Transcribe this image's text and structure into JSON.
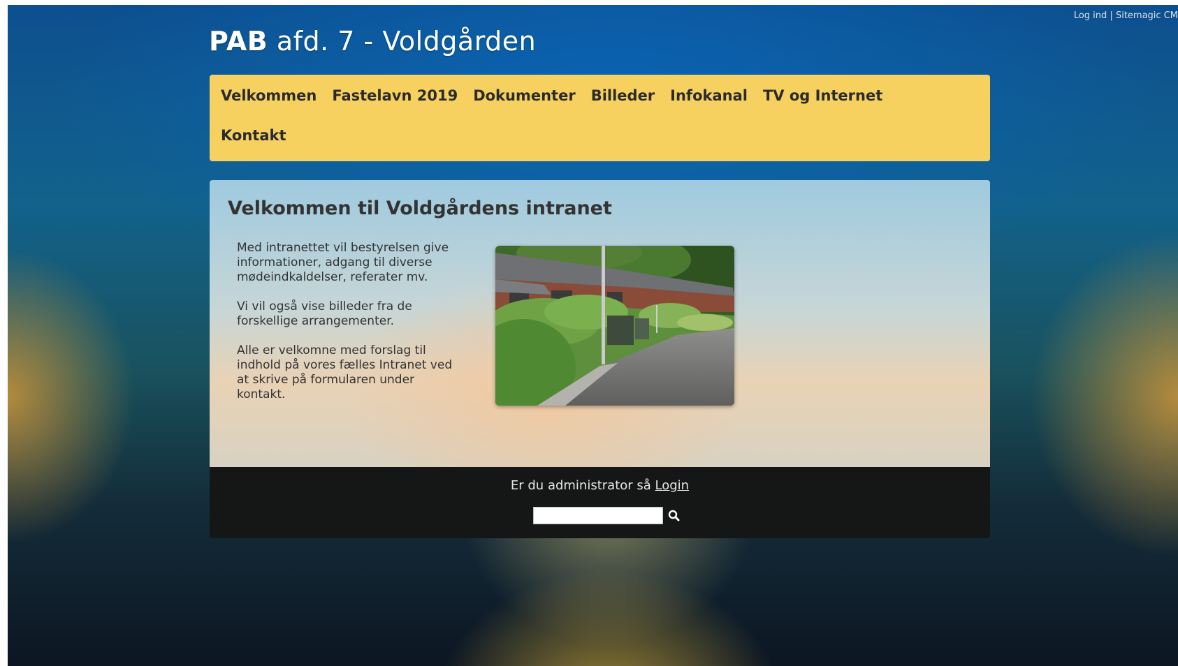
{
  "toplinks": {
    "login": "Log ind",
    "separator": "|",
    "sitemagic": "Sitemagic CM"
  },
  "site": {
    "title_bold": "PAB",
    "title_rest": " afd. 7 - Voldgården"
  },
  "nav": {
    "items": [
      {
        "label": "Velkommen"
      },
      {
        "label": "Fastelavn 2019"
      },
      {
        "label": "Dokumenter"
      },
      {
        "label": "Billeder"
      },
      {
        "label": "Infokanal"
      },
      {
        "label": "TV og Internet"
      },
      {
        "label": "Kontakt"
      }
    ]
  },
  "content": {
    "heading": "Velkommen til Voldgårdens intranet",
    "paragraphs": [
      "Med intranettet vil bestyrelsen give informationer, adgang til diverse mødeindkaldelser, referater mv.",
      "Vi vil også vise billeder fra de forskellige arrangementer.",
      "Alle er velkomne med forslag til indhold på vores fælles Intranet ved at skrive på formularen under kontakt."
    ]
  },
  "footer": {
    "admin_text": "Er du administrator så ",
    "login_link": "Login",
    "search_value": "",
    "search_icon": "magnifier-icon"
  },
  "colors": {
    "nav_background": "#f6d160",
    "footer_background": "#151616",
    "text_dark": "#333333"
  }
}
